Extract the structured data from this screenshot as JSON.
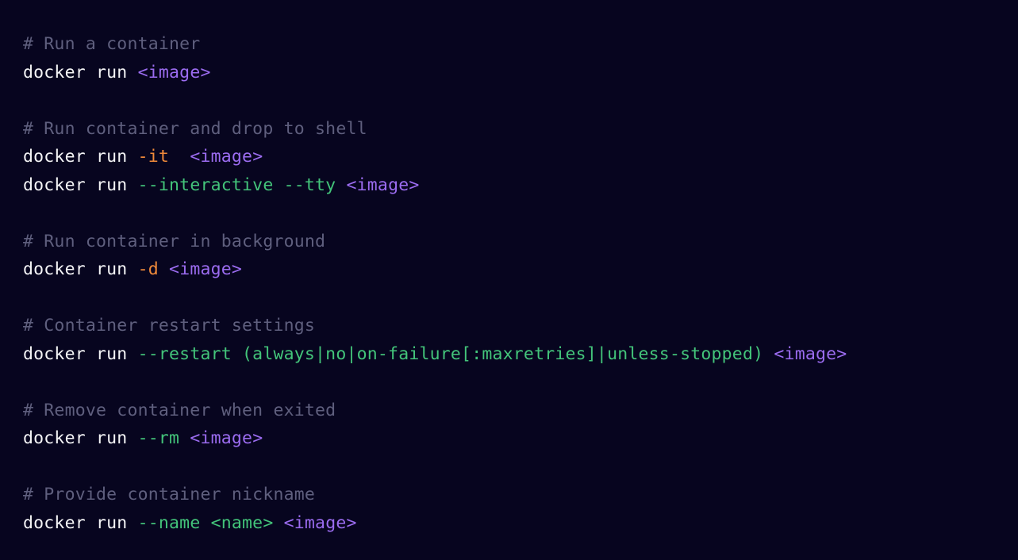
{
  "code": {
    "sections": [
      {
        "comment": "# Run a container",
        "commands": [
          [
            {
              "text": "docker run ",
              "kind": "plain"
            },
            {
              "text": "<image>",
              "kind": "arg"
            }
          ]
        ]
      },
      {
        "comment": "# Run container and drop to shell",
        "commands": [
          [
            {
              "text": "docker run ",
              "kind": "plain"
            },
            {
              "text": "-it",
              "kind": "flag-short"
            },
            {
              "text": "  ",
              "kind": "plain"
            },
            {
              "text": "<image>",
              "kind": "arg"
            }
          ],
          [
            {
              "text": "docker run ",
              "kind": "plain"
            },
            {
              "text": "--interactive --tty",
              "kind": "flag-long"
            },
            {
              "text": " ",
              "kind": "plain"
            },
            {
              "text": "<image>",
              "kind": "arg"
            }
          ]
        ]
      },
      {
        "comment": "# Run container in background",
        "commands": [
          [
            {
              "text": "docker run ",
              "kind": "plain"
            },
            {
              "text": "-d",
              "kind": "flag-short"
            },
            {
              "text": " ",
              "kind": "plain"
            },
            {
              "text": "<image>",
              "kind": "arg"
            }
          ]
        ]
      },
      {
        "comment": "# Container restart settings",
        "commands": [
          [
            {
              "text": "docker run ",
              "kind": "plain"
            },
            {
              "text": "--restart (always|no|on-failure[:maxretries]|unless-stopped)",
              "kind": "flag-long"
            },
            {
              "text": " ",
              "kind": "plain"
            },
            {
              "text": "<image>",
              "kind": "arg"
            }
          ]
        ]
      },
      {
        "comment": "# Remove container when exited",
        "commands": [
          [
            {
              "text": "docker run ",
              "kind": "plain"
            },
            {
              "text": "--rm",
              "kind": "flag-long"
            },
            {
              "text": " ",
              "kind": "plain"
            },
            {
              "text": "<image>",
              "kind": "arg"
            }
          ]
        ]
      },
      {
        "comment": "# Provide container nickname",
        "commands": [
          [
            {
              "text": "docker run ",
              "kind": "plain"
            },
            {
              "text": "--name <name>",
              "kind": "flag-long"
            },
            {
              "text": " ",
              "kind": "plain"
            },
            {
              "text": "<image>",
              "kind": "arg"
            }
          ]
        ]
      }
    ]
  },
  "colors": {
    "background": "#07051f",
    "comment": "#5f5f7e",
    "plain": "#f4f4f6",
    "flag_short": "#f08a3a",
    "flag_long": "#43c47a",
    "arg": "#9b6cf0"
  }
}
